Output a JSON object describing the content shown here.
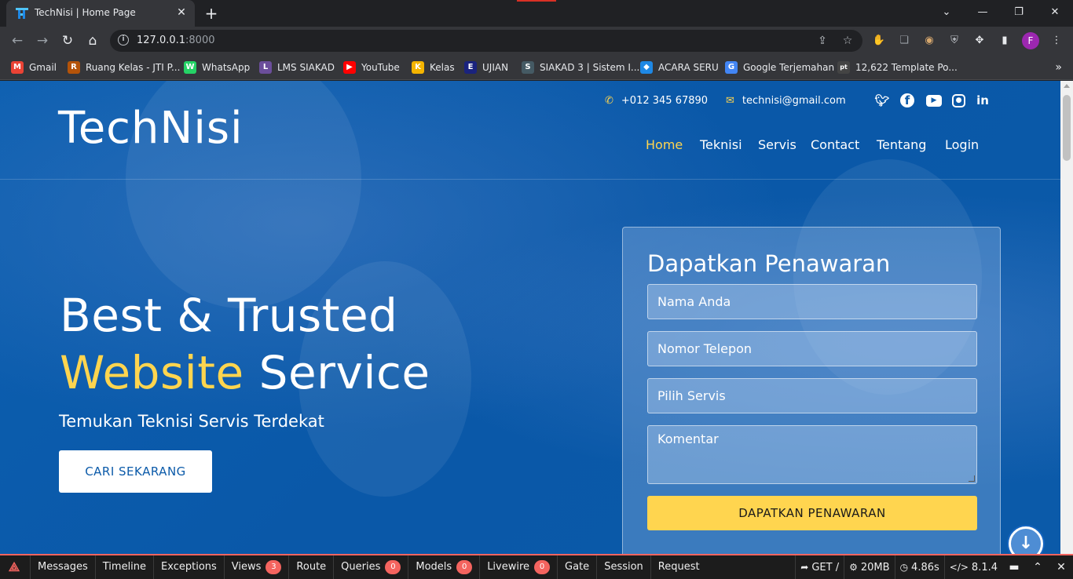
{
  "browser": {
    "tab_title": "TechNisi | Home Page",
    "tab_close": "✕",
    "new_tab": "+",
    "url_host": "127.0.0.1",
    "url_port": ":8000",
    "profile_initial": "F",
    "window_controls": [
      "⌄",
      "—",
      "❐",
      "✕"
    ],
    "bookmarks": [
      {
        "label": "Gmail",
        "icon": "gmail-icon",
        "color": "#ea4335",
        "glyph": "M"
      },
      {
        "label": "Ruang Kelas - JTI P...",
        "icon": "classroom-icon",
        "color": "#b45309",
        "glyph": "R"
      },
      {
        "label": "WhatsApp",
        "icon": "whatsapp-icon",
        "color": "#25d366",
        "glyph": "W"
      },
      {
        "label": "LMS SIAKAD",
        "icon": "lms-icon",
        "color": "#6b4e9b",
        "glyph": "L"
      },
      {
        "label": "YouTube",
        "icon": "youtube-icon",
        "color": "#ff0000",
        "glyph": "▶"
      },
      {
        "label": "Kelas",
        "icon": "kelas-icon",
        "color": "#f4b400",
        "glyph": "K"
      },
      {
        "label": "UJIAN",
        "icon": "ujian-icon",
        "color": "#1a237e",
        "glyph": "E"
      },
      {
        "label": "SIAKAD 3 | Sistem I...",
        "icon": "siakad-icon",
        "color": "#455a64",
        "glyph": "S"
      },
      {
        "label": "ACARA SERU",
        "icon": "acara-icon",
        "color": "#1e88e5",
        "glyph": "◆"
      },
      {
        "label": "Google Terjemahan",
        "icon": "translate-icon",
        "color": "#4285f4",
        "glyph": "G"
      },
      {
        "label": "12,622 Template Po...",
        "icon": "pt-icon",
        "color": "#444444",
        "glyph": "pt"
      }
    ],
    "bookmarks_more": "»"
  },
  "header": {
    "brand": "TechNisi",
    "phone": "+012 345 67890",
    "email": "technisi@gmail.com",
    "nav": [
      "Home",
      "Teknisi",
      "Servis",
      "Contact",
      "Tentang",
      "Login"
    ]
  },
  "hero": {
    "line1": "Best & Trusted",
    "line2_accent": "Website",
    "line2_rest": " Service",
    "subtitle": "Temukan Teknisi Servis Terdekat",
    "cta": "CARI SEKARANG"
  },
  "form": {
    "title": "Dapatkan Penawaran",
    "fields": [
      "Nama Anda",
      "Nomor Telepon",
      "Pilih Servis",
      "Komentar"
    ],
    "submit": "DAPATKAN PENAWARAN"
  },
  "debugbar": {
    "tabs": [
      {
        "label": "Messages",
        "badge": ""
      },
      {
        "label": "Timeline",
        "badge": ""
      },
      {
        "label": "Exceptions",
        "badge": ""
      },
      {
        "label": "Views",
        "badge": "3"
      },
      {
        "label": "Route",
        "badge": ""
      },
      {
        "label": "Queries",
        "badge": "0"
      },
      {
        "label": "Models",
        "badge": "0"
      },
      {
        "label": "Livewire",
        "badge": "0"
      },
      {
        "label": "Gate",
        "badge": ""
      },
      {
        "label": "Session",
        "badge": ""
      },
      {
        "label": "Request",
        "badge": ""
      }
    ],
    "method": "GET /",
    "memory": "20MB",
    "time": "4.86s",
    "php_version": "8.1.4"
  },
  "colors": {
    "page_blue": "#0b5aa9",
    "accent_yellow": "#ffd54f",
    "debug_red": "#f4645f"
  }
}
